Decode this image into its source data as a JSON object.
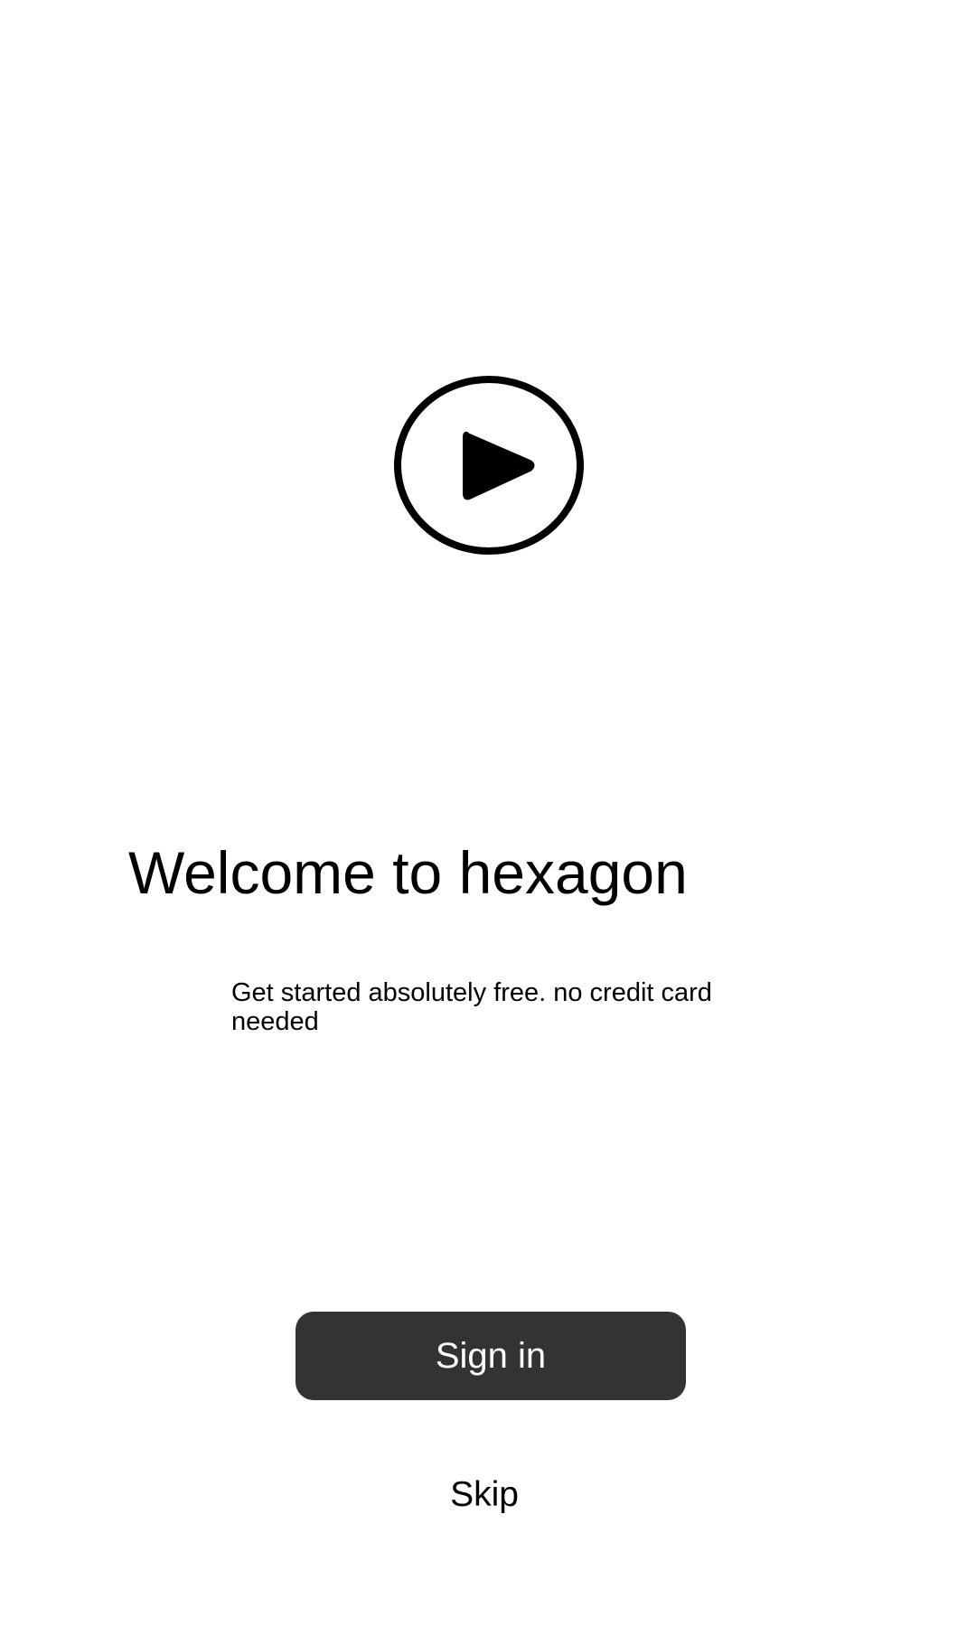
{
  "app": {
    "name": "hexagon"
  },
  "hero": {
    "icon": "play-circle-icon"
  },
  "welcome": {
    "title": "Welcome to hexagon",
    "subtitle": "Get started absolutely free. no credit card needed"
  },
  "actions": {
    "sign_in_label": "Sign in",
    "skip_label": "Skip"
  },
  "colors": {
    "background": "#ffffff",
    "primary_button": "#333333",
    "primary_button_text": "#ffffff",
    "text": "#000000"
  }
}
